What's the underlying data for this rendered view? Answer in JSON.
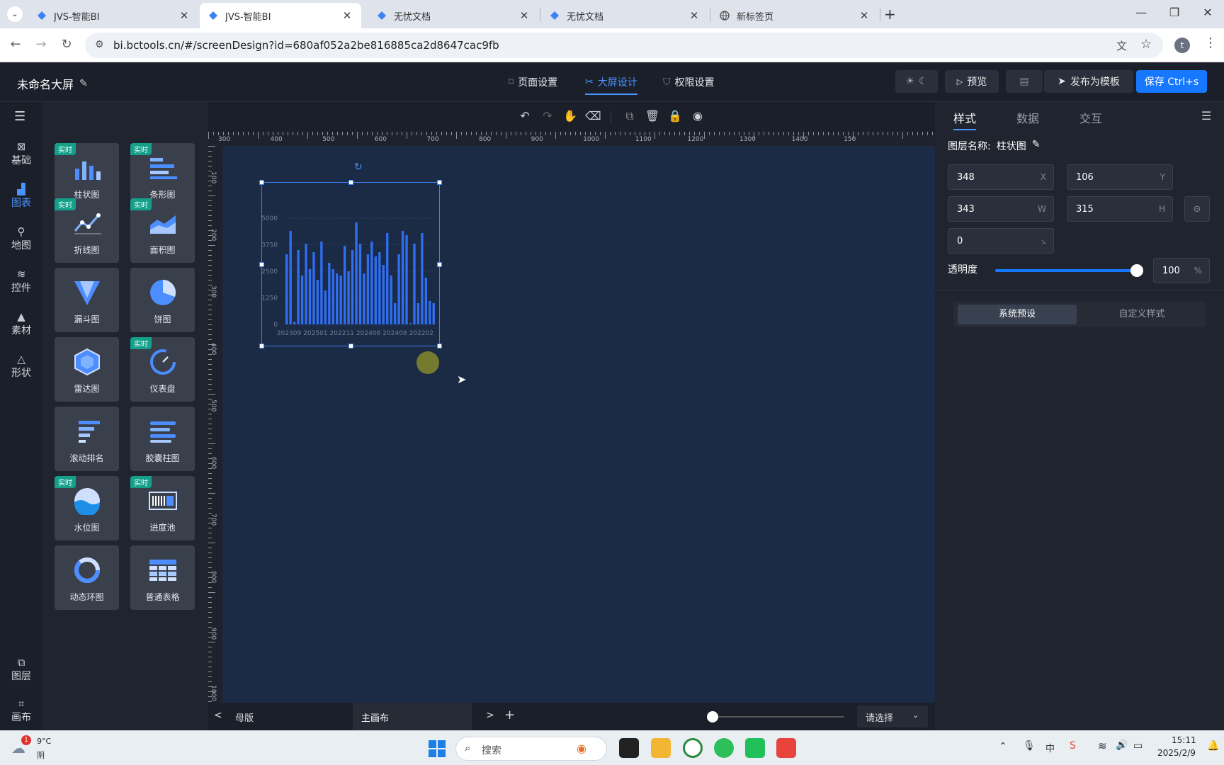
{
  "browser": {
    "tabs": [
      {
        "title": "JVS-智能BI",
        "active": false
      },
      {
        "title": "JVS-智能BI",
        "active": true
      },
      {
        "title": "无忧文档",
        "active": false
      },
      {
        "title": "无忧文档",
        "active": false
      },
      {
        "title": "新标签页",
        "active": false
      }
    ],
    "url": "bi.bctools.cn/#/screenDesign?id=680af052a2be816885ca2d8647cac9fb",
    "profile_initial": "t"
  },
  "header": {
    "title": "未命名大屏",
    "nav": [
      {
        "label": "页面设置"
      },
      {
        "label": "大屏设计"
      },
      {
        "label": "权限设置"
      }
    ],
    "preview_label": "预览",
    "publish_label": "发布为模板",
    "save_label": "保存 Ctrl+s"
  },
  "rail": {
    "items": [
      {
        "label": "基础"
      },
      {
        "label": "图表"
      },
      {
        "label": "地图"
      },
      {
        "label": "控件"
      },
      {
        "label": "素材"
      },
      {
        "label": "形状"
      }
    ],
    "bottom": [
      {
        "label": "图层"
      },
      {
        "label": "画布"
      }
    ]
  },
  "components": [
    {
      "label": "柱状图",
      "badge": "实时"
    },
    {
      "label": "条形图",
      "badge": "实时"
    },
    {
      "label": "折线图",
      "badge": "实时"
    },
    {
      "label": "面积图",
      "badge": "实时"
    },
    {
      "label": "漏斗图",
      "badge": ""
    },
    {
      "label": "饼图",
      "badge": ""
    },
    {
      "label": "雷达图",
      "badge": ""
    },
    {
      "label": "仪表盘",
      "badge": "实时"
    },
    {
      "label": "滚动排名",
      "badge": ""
    },
    {
      "label": "胶囊柱图",
      "badge": ""
    },
    {
      "label": "水位图",
      "badge": "实时"
    },
    {
      "label": "进度池",
      "badge": "实时"
    },
    {
      "label": "动态环图",
      "badge": ""
    },
    {
      "label": "普通表格",
      "badge": ""
    }
  ],
  "rulers": {
    "h": [
      "300",
      "400",
      "500",
      "600",
      "700",
      "800",
      "900",
      "1000",
      "1100",
      "1200",
      "1300",
      "1400",
      "150"
    ],
    "v": [
      "100",
      "200",
      "300",
      "400",
      "500",
      "600",
      "700",
      "800",
      "900",
      "1000"
    ]
  },
  "chart_data": {
    "type": "bar",
    "yticks": [
      "5000",
      "3750",
      "2500",
      "1250",
      "0"
    ],
    "ylim": [
      0,
      5000
    ],
    "xticks": [
      "202309",
      "202501",
      "202211",
      "202406",
      "202408",
      "202202"
    ],
    "values": [
      3300,
      4400,
      120,
      3500,
      2300,
      3800,
      2600,
      3400,
      2100,
      3900,
      1600,
      2900,
      2600,
      2400,
      2300,
      3700,
      2500,
      3500,
      4800,
      3800,
      2400,
      3300,
      3900,
      3200,
      3400,
      2800,
      4300,
      2300,
      1000,
      3300,
      4400,
      4200,
      60,
      3800,
      1000,
      4300,
      2200,
      1100,
      1000
    ],
    "grid": true
  },
  "properties": {
    "tabs": [
      {
        "label": "样式"
      },
      {
        "label": "数据"
      },
      {
        "label": "交互"
      }
    ],
    "layer_name_label": "图层名称:",
    "layer_name": "柱状图",
    "x": {
      "value": "348",
      "unit": "X"
    },
    "y": {
      "value": "106",
      "unit": "Y"
    },
    "w": {
      "value": "343",
      "unit": "W"
    },
    "h": {
      "value": "315",
      "unit": "H"
    },
    "rotation": "0",
    "opacity_label": "透明度",
    "opacity": "100",
    "opacity_unit": "%",
    "opacity_fraction": 1.0,
    "style_tabs": [
      {
        "label": "系统预设"
      },
      {
        "label": "自定义样式"
      }
    ]
  },
  "bottom": {
    "master_label": "母版",
    "main_canvas_label": "主画布",
    "select_placeholder": "请选择",
    "zoom_fraction": 0.0
  },
  "taskbar": {
    "temp": "9°C",
    "weather": "阴",
    "weather_badge": "1",
    "search_placeholder": "搜索",
    "ime": "中",
    "time": "15:11",
    "date": "2025/2/9"
  },
  "colors": {
    "accent": "#1677ff",
    "canvas": "#1b2a45",
    "bar": "#2f6ef0",
    "badge": "#14a08a"
  }
}
